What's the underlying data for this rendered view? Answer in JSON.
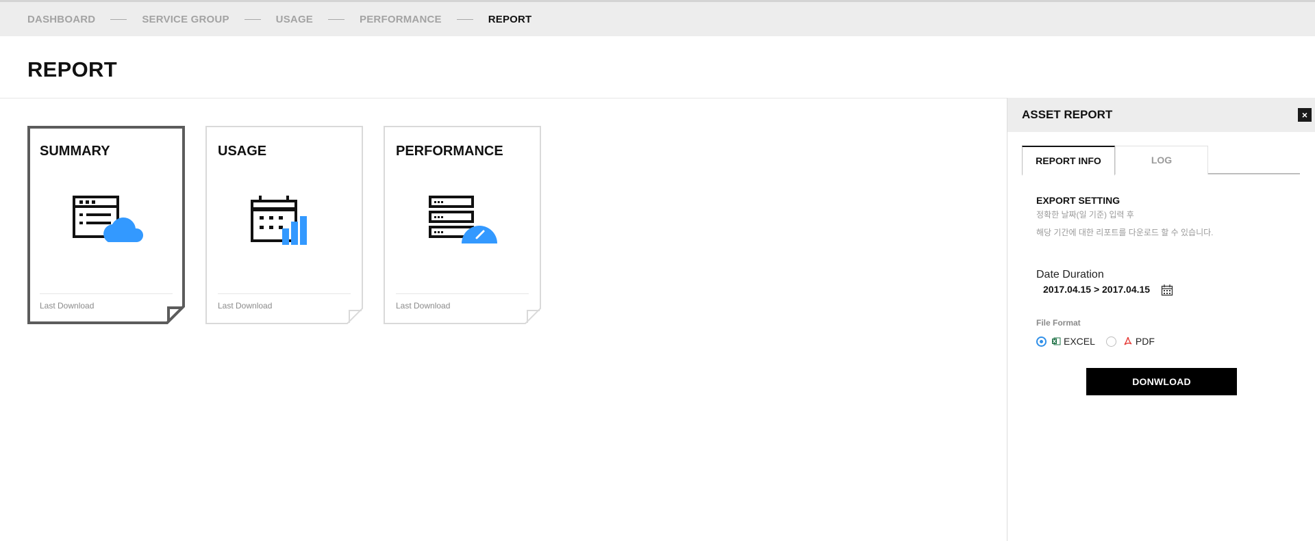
{
  "breadcrumb": [
    "DASHBOARD",
    "SERVICE GROUP",
    "USAGE",
    "PERFORMANCE",
    "REPORT"
  ],
  "page_title": "REPORT",
  "cards": [
    {
      "title": "SUMMARY",
      "footer": "Last Download",
      "icon": "server-cloud-icon",
      "selected": true
    },
    {
      "title": "USAGE",
      "footer": "Last Download",
      "icon": "calendar-chart-icon",
      "selected": false
    },
    {
      "title": "PERFORMANCE",
      "footer": "Last Download",
      "icon": "server-gauge-icon",
      "selected": false
    }
  ],
  "panel": {
    "title": "ASSET REPORT",
    "close_icon": "close-icon",
    "tabs": [
      {
        "label": "REPORT INFO",
        "active": true
      },
      {
        "label": "LOG",
        "active": false
      }
    ],
    "export_title": "EXPORT SETTING",
    "desc_line1": "정확한 날짜(일 기준) 입력 후",
    "desc_line2": "해당 기간에 대한 리포트를 다운로드 할 수 있습니다.",
    "date_duration_label": "Date Duration",
    "date_value": "2017.04.15 > 2017.04.15",
    "calendar_icon": "calendar-icon",
    "file_format_label": "File Format",
    "formats": [
      {
        "label": "EXCEL",
        "checked": true,
        "icon": "excel-icon"
      },
      {
        "label": "PDF",
        "checked": false,
        "icon": "pdf-icon"
      }
    ],
    "download_label": "DONWLOAD"
  },
  "colors": {
    "accent": "#3399ff",
    "selected_border": "#5c5c5c",
    "radio": "#2f8fe8",
    "excel": "#1e7145",
    "pdf": "#e53935"
  }
}
